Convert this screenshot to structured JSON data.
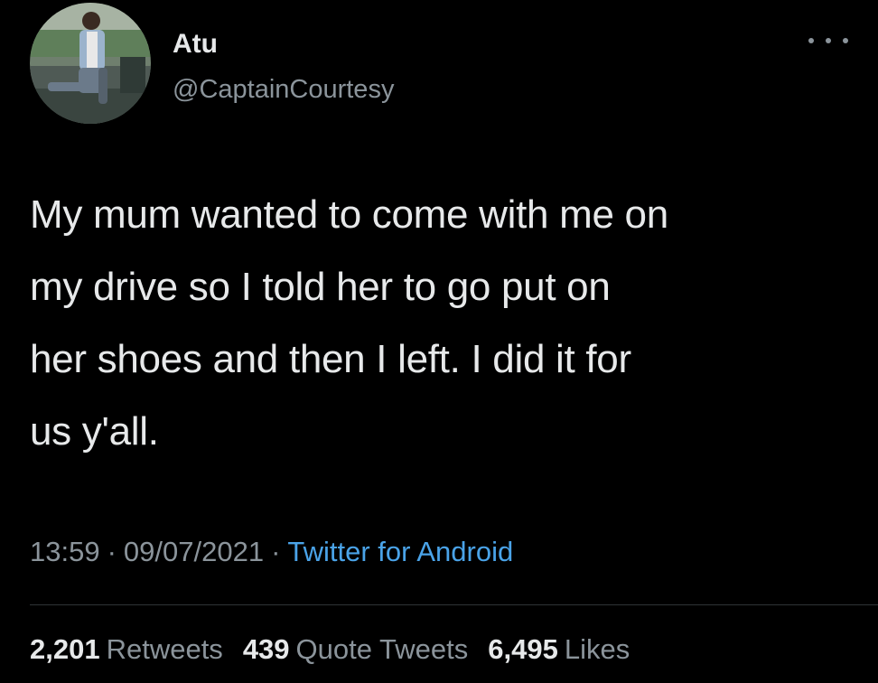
{
  "user": {
    "display_name": "Atu",
    "handle": "@CaptainCourtesy"
  },
  "menu": {
    "icon": "more-horizontal-icon"
  },
  "tweet": {
    "lines": [
      "My mum wanted to come with me on",
      "my drive so I told her to go put on",
      "her shoes and then I left. I did it for",
      "us y'all."
    ]
  },
  "meta": {
    "time": "13:59",
    "separator": "·",
    "date": "09/07/2021",
    "source": "Twitter for Android"
  },
  "stats": {
    "retweets_count": "2,201",
    "retweets_label": "Retweets",
    "quotes_count": "439",
    "quotes_label": "Quote Tweets",
    "likes_count": "6,495",
    "likes_label": "Likes"
  },
  "colors": {
    "background": "#000000",
    "text": "#e7e9ea",
    "secondary": "#8b949b",
    "link": "#4aa3e8",
    "divider": "#2f3336"
  }
}
